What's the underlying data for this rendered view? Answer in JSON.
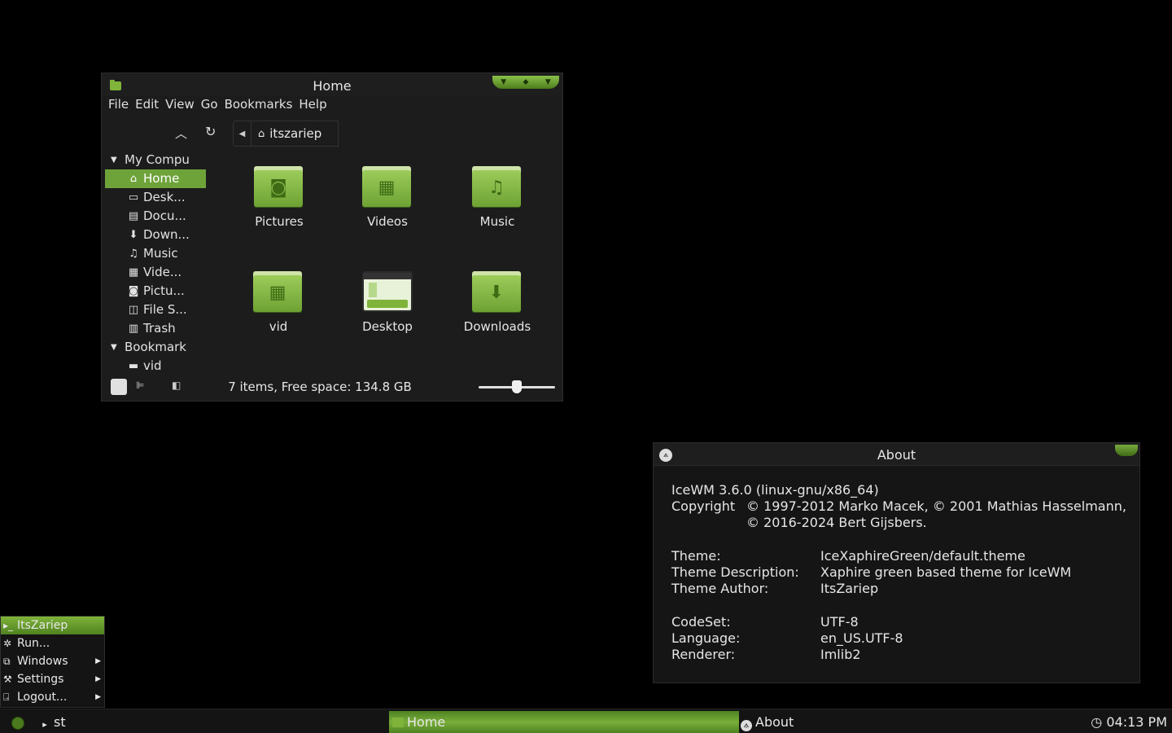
{
  "colors": {
    "accent": "#6ea33a",
    "background": "#000000",
    "window": "#1c1c1c"
  },
  "file_manager": {
    "title": "Home",
    "menu": [
      "File",
      "Edit",
      "View",
      "Go",
      "Bookmarks",
      "Help"
    ],
    "path": "itszariep",
    "sidebar": {
      "my_computer": "My Compu",
      "items": [
        {
          "label": "Home",
          "icon": "home-icon"
        },
        {
          "label": "Desk...",
          "icon": "desktop-icon"
        },
        {
          "label": "Docu...",
          "icon": "document-icon"
        },
        {
          "label": "Down...",
          "icon": "download-icon"
        },
        {
          "label": "Music",
          "icon": "music-icon"
        },
        {
          "label": "Vide...",
          "icon": "video-icon"
        },
        {
          "label": "Pictu...",
          "icon": "camera-icon"
        },
        {
          "label": "File S...",
          "icon": "filesystem-icon"
        },
        {
          "label": "Trash",
          "icon": "trash-icon"
        }
      ],
      "bookmarks": "Bookmark",
      "bookmark_items": [
        {
          "label": "vid",
          "icon": "folder-icon"
        }
      ]
    },
    "files": [
      {
        "label": "Pictures",
        "icon": "camera-icon"
      },
      {
        "label": "Videos",
        "icon": "film-icon"
      },
      {
        "label": "Music",
        "icon": "music-icon"
      },
      {
        "label": "vid",
        "icon": "film-icon"
      },
      {
        "label": "Desktop",
        "icon": "desktop-icon"
      },
      {
        "label": "Downloads",
        "icon": "download-icon"
      }
    ],
    "status": "7 items, Free space: 134.8 GB",
    "zoom_level": 0.5
  },
  "about": {
    "title": "About",
    "version": "IceWM 3.6.0 (linux-gnu/x86_64)",
    "copyright_label": "Copyright",
    "copyright_line1": "© 1997-2012 Marko Macek, © 2001 Mathias Hasselmann,",
    "copyright_line2": "© 2016-2024 Bert Gijsbers.",
    "theme_label": "Theme:",
    "theme": "IceXaphireGreen/default.theme",
    "desc_label": "Theme Description:",
    "desc": "Xaphire green based theme for IceWM",
    "author_label": "Theme Author:",
    "author": "ItsZariep",
    "codeset_label": "CodeSet:",
    "codeset": "UTF-8",
    "language_label": "Language:",
    "language": "en_US.UTF-8",
    "renderer_label": "Renderer:",
    "renderer": "Imlib2"
  },
  "start_menu": {
    "items": [
      {
        "label": "ItsZariep",
        "icon": "terminal-icon"
      },
      {
        "label": "Run...",
        "icon": "gear-icon"
      },
      {
        "label": "Windows",
        "icon": "windows-icon"
      },
      {
        "label": "Settings",
        "icon": "wrench-icon"
      },
      {
        "label": "Logout...",
        "icon": "logout-icon"
      }
    ]
  },
  "taskbar": {
    "terminal": "st",
    "home_task": "Home",
    "about_task": "About",
    "clock": "04:13 PM"
  }
}
